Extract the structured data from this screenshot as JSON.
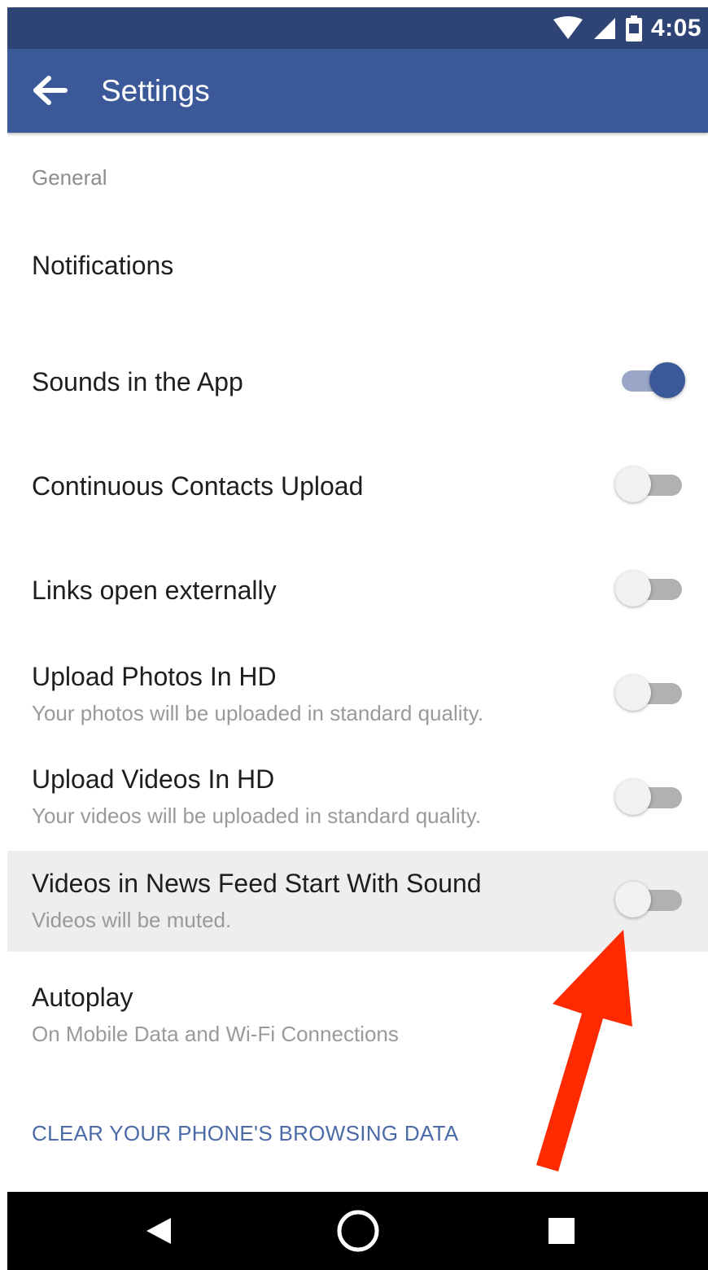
{
  "status_bar": {
    "time": "4:05"
  },
  "app_bar": {
    "title": "Settings"
  },
  "section": {
    "header": "General"
  },
  "rows": [
    {
      "title": "Notifications"
    },
    {
      "title": "Sounds in the App",
      "toggle_on": true
    },
    {
      "title": "Continuous Contacts Upload",
      "toggle_on": false
    },
    {
      "title": "Links open externally",
      "toggle_on": false
    },
    {
      "title": "Upload Photos In HD",
      "subtitle": "Your photos will be uploaded in standard quality.",
      "toggle_on": false
    },
    {
      "title": "Upload Videos In HD",
      "subtitle": "Your videos will be uploaded in standard quality.",
      "toggle_on": false
    },
    {
      "title": "Videos in News Feed Start With Sound",
      "subtitle": "Videos will be muted.",
      "toggle_on": false
    },
    {
      "title": "Autoplay",
      "subtitle": "On Mobile Data and Wi-Fi Connections"
    }
  ],
  "clear_data_link": "CLEAR YOUR PHONE'S BROWSING DATA",
  "icons": {
    "wifi": "wifi-icon",
    "signal": "signal-icon",
    "battery": "battery-icon",
    "back": "back-arrow-icon",
    "nav_back": "triangle-back-icon",
    "nav_home": "circle-home-icon",
    "nav_recents": "square-recents-icon",
    "annotation": "red-arrow-icon"
  },
  "colors": {
    "status_bar": "#2e4475",
    "app_bar": "#3b5998",
    "toggle_on": "#3b5998",
    "link": "#4b6aa8",
    "highlight_row": "#eeeeee",
    "annotation_arrow": "#ff2a00"
  }
}
